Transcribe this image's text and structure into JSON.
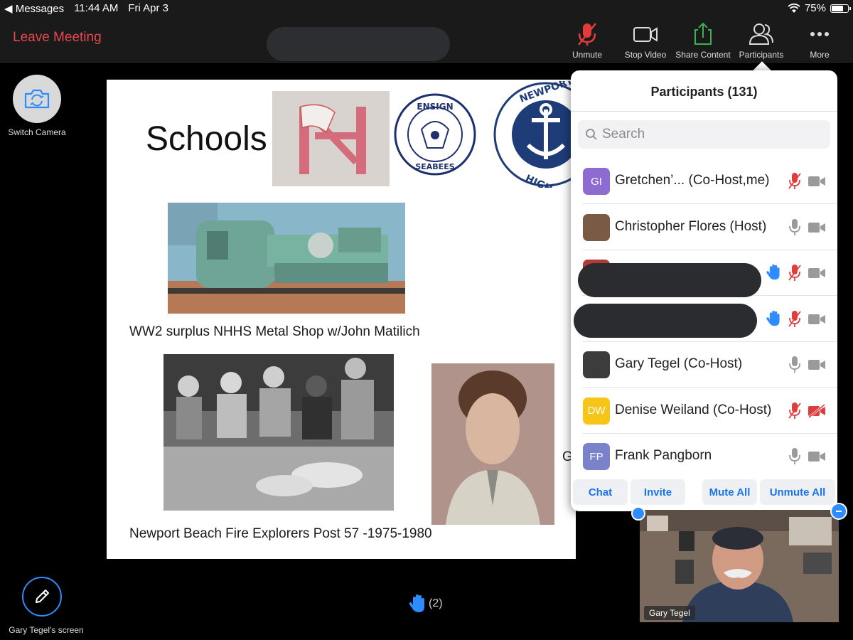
{
  "status_bar": {
    "back_app": "◀ Messages",
    "time": "11:44 AM",
    "date": "Fri Apr 3",
    "battery_percent": "75%",
    "battery_level": 0.75
  },
  "toolbar": {
    "leave_label": "Leave Meeting",
    "unmute_label": "Unmute",
    "stop_video_label": "Stop Video",
    "share_content_label": "Share Content",
    "participants_label": "Participants",
    "more_label": "More"
  },
  "left_controls": {
    "switch_camera_label": "Switch Camera",
    "screen_owner_label": "Gary Tegel's screen"
  },
  "slide": {
    "title": "Schools",
    "caption_1": "WW2 surplus NHHS Metal Shop w/John Matilich",
    "caption_2": "Newport Beach Fire Explorers Post 57 -1975-1980",
    "partial_text": "G",
    "logo_ensign_top": "ENSIGN",
    "logo_ensign_bottom": "SEABEES",
    "logo_newport": "NEWPORT HA",
    "logo_newport_bottom": "HIGH SCHO"
  },
  "participants_panel": {
    "title": "Participants (131)",
    "search_placeholder": "Search",
    "participants": [
      {
        "initials": "GI",
        "name": "Gretchen’...",
        "role": " (Co-Host,me)",
        "color": "#8e6bd1",
        "mic": "muted",
        "video": "off",
        "hand": false
      },
      {
        "initials": "",
        "name": "Christopher Flores",
        "role": " (Host)",
        "color": "#7a5a44",
        "mic": "on",
        "video": "off",
        "hand": false
      },
      {
        "initials": "",
        "name": "",
        "role": "",
        "color": "#b23a3a",
        "mic": "muted",
        "video": "off",
        "hand": true
      },
      {
        "initials": "",
        "name": "",
        "role": "",
        "color": "#999999",
        "mic": "muted",
        "video": "off",
        "hand": true
      },
      {
        "initials": "",
        "name": "Gary Tegel",
        "role": " (Co-Host)",
        "color": "#3c3c3c",
        "mic": "on",
        "video": "off",
        "hand": false
      },
      {
        "initials": "DW",
        "name": "Denise Weiland",
        "role": " (Co-Host)",
        "color": "#f5c518",
        "mic": "muted",
        "video": "blocked",
        "hand": false
      },
      {
        "initials": "FP",
        "name": "Frank Pangborn",
        "role": "",
        "color": "#7a83c9",
        "mic": "on",
        "video": "off",
        "hand": false
      }
    ],
    "actions": {
      "chat": "Chat",
      "invite": "Invite",
      "mute_all": "Mute All",
      "unmute_all": "Unmute All"
    }
  },
  "self_view": {
    "name_label": "Gary Tegel"
  },
  "raised_hands": {
    "count_label": "(2)"
  },
  "colors": {
    "accent": "#2d8cff",
    "leave_red": "#e5484d",
    "mute_red": "#e03c3c",
    "hand_blue": "#2d8cff",
    "share_green": "#3bb34a"
  }
}
